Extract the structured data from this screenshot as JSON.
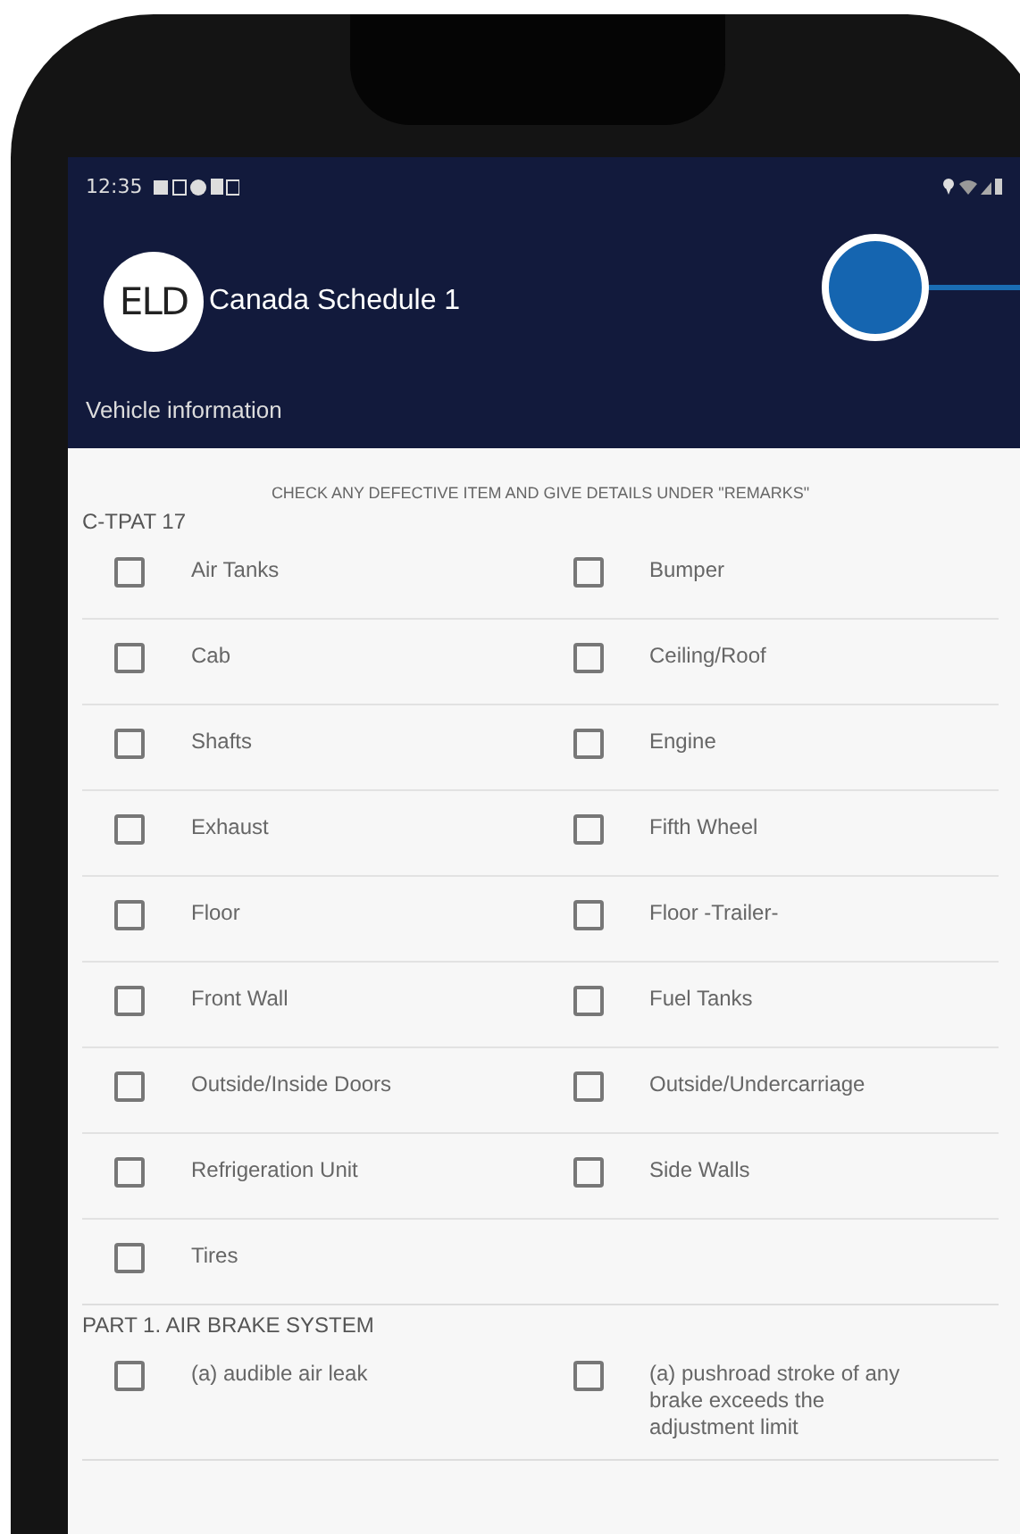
{
  "status_bar": {
    "time": "12:35"
  },
  "header": {
    "logo": "ELD",
    "title": "Canada Schedule 1",
    "subtitle": "Vehicle information"
  },
  "instruction": "CHECK ANY DEFECTIVE ITEM AND GIVE DETAILS UNDER \"REMARKS\"",
  "sections": [
    {
      "title": "C-TPAT 17",
      "items": [
        {
          "label": "Air Tanks",
          "checked": false
        },
        {
          "label": "Bumper",
          "checked": false
        },
        {
          "label": "Cab",
          "checked": false
        },
        {
          "label": "Ceiling/Roof",
          "checked": false
        },
        {
          "label": "Shafts",
          "checked": false
        },
        {
          "label": "Engine",
          "checked": false
        },
        {
          "label": "Exhaust",
          "checked": false
        },
        {
          "label": "Fifth Wheel",
          "checked": false
        },
        {
          "label": "Floor",
          "checked": false
        },
        {
          "label": "Floor -Trailer-",
          "checked": false
        },
        {
          "label": "Front Wall",
          "checked": false
        },
        {
          "label": "Fuel Tanks",
          "checked": false
        },
        {
          "label": "Outside/Inside Doors",
          "checked": false
        },
        {
          "label": "Outside/Undercarriage",
          "checked": false
        },
        {
          "label": "Refrigeration Unit",
          "checked": false
        },
        {
          "label": "Side Walls",
          "checked": false
        },
        {
          "label": "Tires",
          "checked": false
        }
      ]
    },
    {
      "title": "PART 1. AIR BRAKE SYSTEM",
      "items": [
        {
          "label": "(a) audible air leak",
          "checked": false
        },
        {
          "label": "(a) pushroad stroke of any brake exceeds the adjustment limit",
          "checked": false
        }
      ]
    }
  ]
}
